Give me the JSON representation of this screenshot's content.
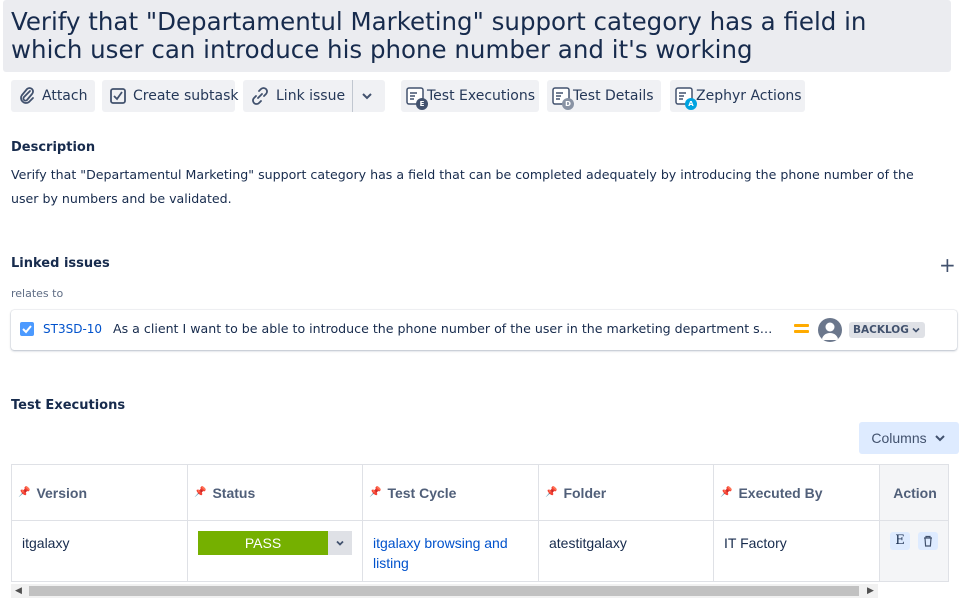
{
  "issue": {
    "title": "Verify that \"Departamentul Marketing\" support category has a field in which user can introduce his phone number and it's working"
  },
  "toolbar": {
    "attach": "Attach",
    "create_subtask": "Create subtask",
    "link_issue": "Link issue",
    "test_executions": "Test Executions",
    "test_details": "Test Details",
    "zephyr_actions": "Zephyr Actions"
  },
  "description": {
    "label": "Description",
    "text": "Verify that \"Departamentul Marketing\" support category has a field that can be completed adequately by introducing the phone number of the user by numbers and be validated."
  },
  "linked_issues": {
    "label": "Linked issues",
    "relation": "relates to",
    "items": [
      {
        "key": "ST3SD-10",
        "summary": "As a client I want to be able to introduce the phone number of the user in the marketing department section",
        "status": "BACKLOG"
      }
    ]
  },
  "test_executions": {
    "label": "Test Executions",
    "columns_button": "Columns",
    "headers": [
      "Version",
      "Status",
      "Test Cycle",
      "Folder",
      "Executed By",
      "Action"
    ],
    "rows": [
      {
        "version": "itgalaxy",
        "status": "PASS",
        "test_cycle": "itgalaxy browsing and listing",
        "folder": "atestitgalaxy",
        "executed_by": "IT Factory",
        "action_e": "E"
      }
    ]
  },
  "colors": {
    "pass": "#75b000",
    "link": "#0052cc",
    "title_bg": "#ebecf0",
    "button_bg": "#f0f1f4",
    "priority": "#ffab00"
  },
  "icons": [
    "attach-icon",
    "subtask-icon",
    "link-icon",
    "chevron-down-icon",
    "test-executions-icon",
    "test-details-icon",
    "zephyr-actions-icon",
    "add-icon",
    "checkbox-icon",
    "priority-medium-icon",
    "avatar",
    "pin-icon",
    "delete-icon"
  ]
}
